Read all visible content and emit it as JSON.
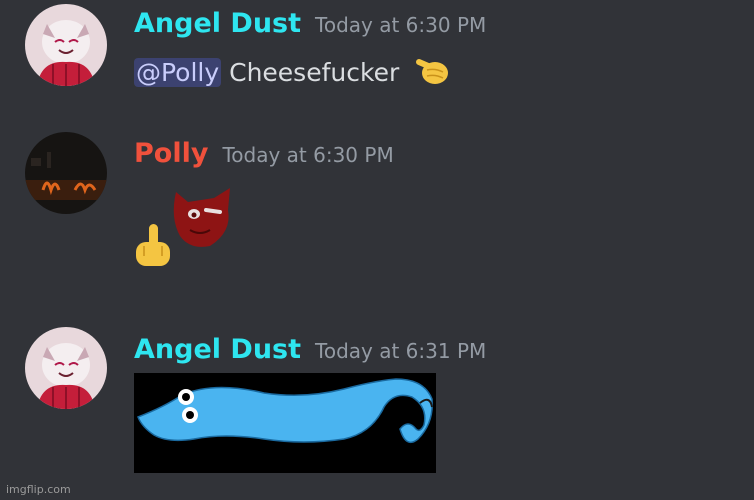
{
  "messages": [
    {
      "username": "Angel Dust",
      "username_color": "#2ee6f0",
      "timestamp": "Today at 6:30 PM",
      "mention": "@Polly",
      "text": " Cheesefucker",
      "emoji": "pointing-hand-icon"
    },
    {
      "username": "Polly",
      "username_color": "#f0513c",
      "timestamp": "Today at 6:30 PM",
      "content": "middle-finger emoji and cat sticker"
    },
    {
      "username": "Angel Dust",
      "username_color": "#2ee6f0",
      "timestamp": "Today at 6:31 PM",
      "attachment": "blue-worm-image"
    }
  ],
  "colors": {
    "background": "#313338",
    "mention_bg": "#3c4270",
    "mention_text": "#c9cdfb",
    "timestamp": "#949ba4"
  },
  "watermark": "imgflip.com"
}
